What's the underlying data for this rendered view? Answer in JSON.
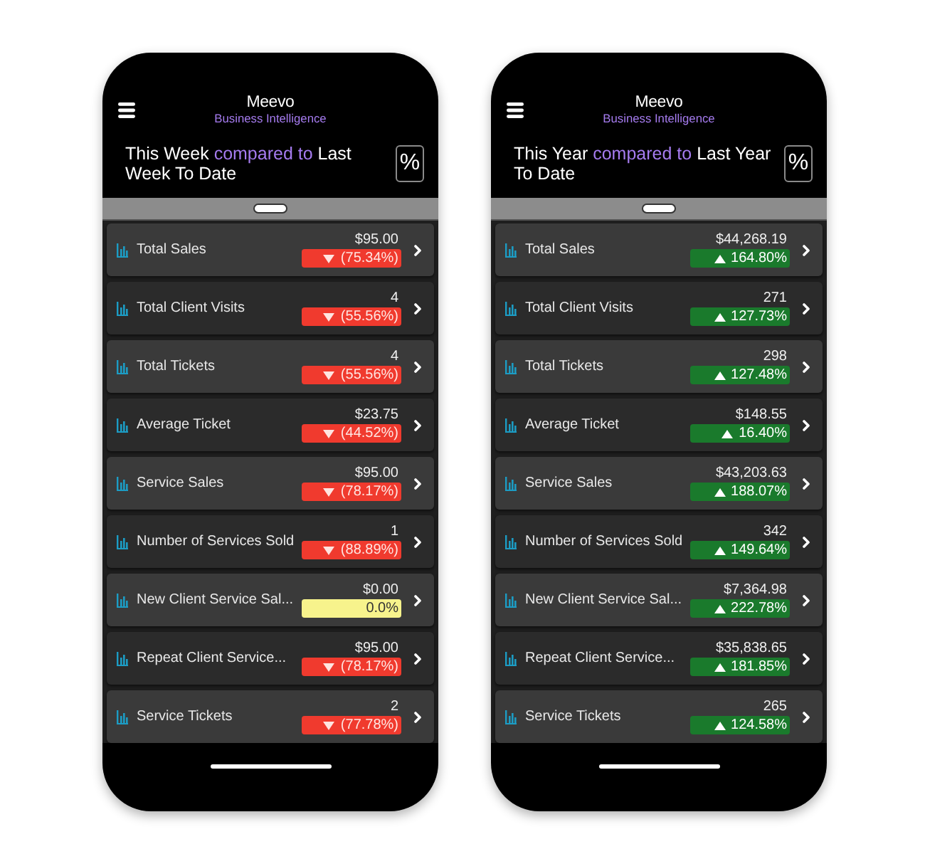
{
  "phones": [
    {
      "logo": "Meevo",
      "tagline": "Business Intelligence",
      "heading": {
        "current": "This Week",
        "connector": "compared to",
        "previous": "Last Week To Date"
      },
      "percent_button": "%",
      "metrics": [
        {
          "label": "Total Sales",
          "value": "$95.00",
          "change": "(75.34%)",
          "kind": "down"
        },
        {
          "label": "Total Client Visits",
          "value": "4",
          "change": "(55.56%)",
          "kind": "down"
        },
        {
          "label": "Total Tickets",
          "value": "4",
          "change": "(55.56%)",
          "kind": "down"
        },
        {
          "label": "Average Ticket",
          "value": "$23.75",
          "change": "(44.52%)",
          "kind": "down"
        },
        {
          "label": "Service Sales",
          "value": "$95.00",
          "change": "(78.17%)",
          "kind": "down"
        },
        {
          "label": "Number of Services Sold",
          "value": "1",
          "change": "(88.89%)",
          "kind": "down"
        },
        {
          "label": "New Client Service Sal...",
          "value": "$0.00",
          "change": "0.0%",
          "kind": "flat"
        },
        {
          "label": "Repeat Client Service...",
          "value": "$95.00",
          "change": "(78.17%)",
          "kind": "down"
        },
        {
          "label": "Service Tickets",
          "value": "2",
          "change": "(77.78%)",
          "kind": "down"
        }
      ]
    },
    {
      "logo": "Meevo",
      "tagline": "Business Intelligence",
      "heading": {
        "current": "This Year",
        "connector": "compared to",
        "previous": "Last Year To Date"
      },
      "percent_button": "%",
      "metrics": [
        {
          "label": "Total Sales",
          "value": "$44,268.19",
          "change": "164.80%",
          "kind": "up"
        },
        {
          "label": "Total Client Visits",
          "value": "271",
          "change": "127.73%",
          "kind": "up"
        },
        {
          "label": "Total Tickets",
          "value": "298",
          "change": "127.48%",
          "kind": "up"
        },
        {
          "label": "Average Ticket",
          "value": "$148.55",
          "change": "16.40%",
          "kind": "up"
        },
        {
          "label": "Service Sales",
          "value": "$43,203.63",
          "change": "188.07%",
          "kind": "up"
        },
        {
          "label": "Number of Services Sold",
          "value": "342",
          "change": "149.64%",
          "kind": "up"
        },
        {
          "label": "New Client Service Sal...",
          "value": "$7,364.98",
          "change": "222.78%",
          "kind": "up"
        },
        {
          "label": "Repeat Client Service...",
          "value": "$35,838.65",
          "change": "181.85%",
          "kind": "up"
        },
        {
          "label": "Service Tickets",
          "value": "265",
          "change": "124.58%",
          "kind": "up"
        }
      ]
    }
  ]
}
